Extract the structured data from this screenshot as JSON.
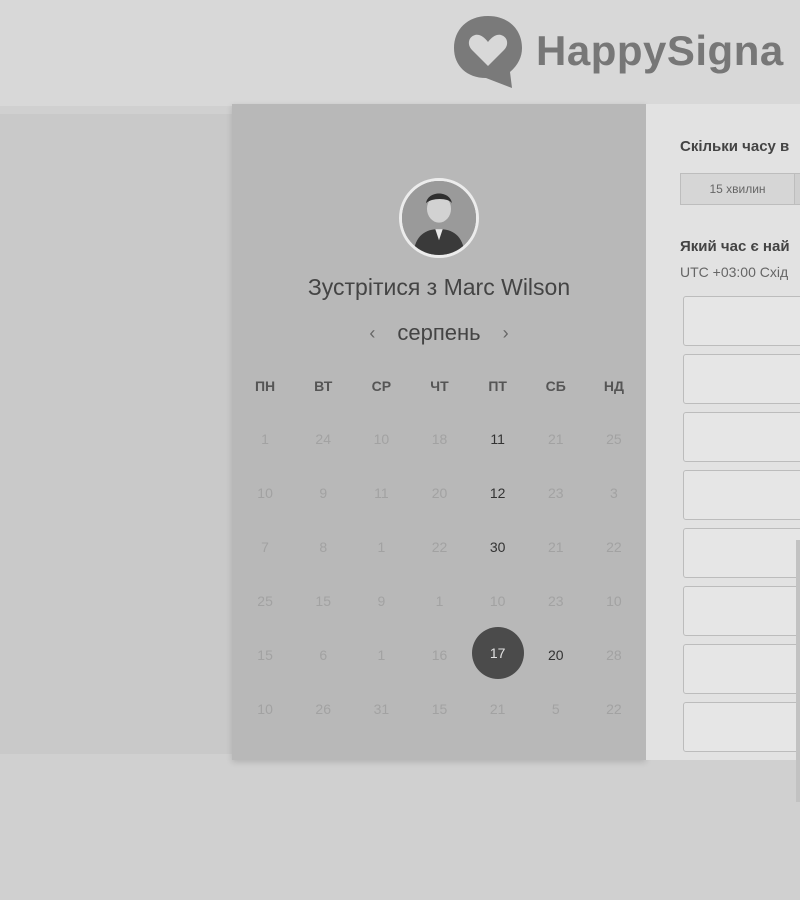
{
  "brand": {
    "name": "HappySigna"
  },
  "card": {
    "title": "Зустрітися з Marc Wilson",
    "month": "серпень",
    "weekdays": [
      "ПН",
      "ВТ",
      "СР",
      "ЧТ",
      "ПТ",
      "СБ",
      "НД"
    ],
    "days": [
      [
        "1",
        "24",
        "10",
        "18",
        "11",
        "21",
        "25"
      ],
      [
        "10",
        "9",
        "11",
        "20",
        "12",
        "23",
        "3"
      ],
      [
        "7",
        "8",
        "1",
        "22",
        "30",
        "21",
        "22"
      ],
      [
        "25",
        "15",
        "9",
        "1",
        "10",
        "23",
        "10"
      ],
      [
        "15",
        "6",
        "1",
        "16",
        "17",
        "20",
        "28"
      ],
      [
        "10",
        "26",
        "31",
        "15",
        "21",
        "5",
        "22"
      ]
    ],
    "available_days": [
      "11",
      "12",
      "30",
      "20"
    ],
    "selected_day": "17"
  },
  "panel": {
    "question_duration": "Скільки часу в",
    "duration_option": "15 хвилин",
    "question_time": "Який час є най",
    "timezone": "UTC +03:00 Схід"
  },
  "colors": {
    "selected": "#4b4b4b",
    "card_bg": "#b8b8b8",
    "panel_bg": "#e2e2e2"
  }
}
